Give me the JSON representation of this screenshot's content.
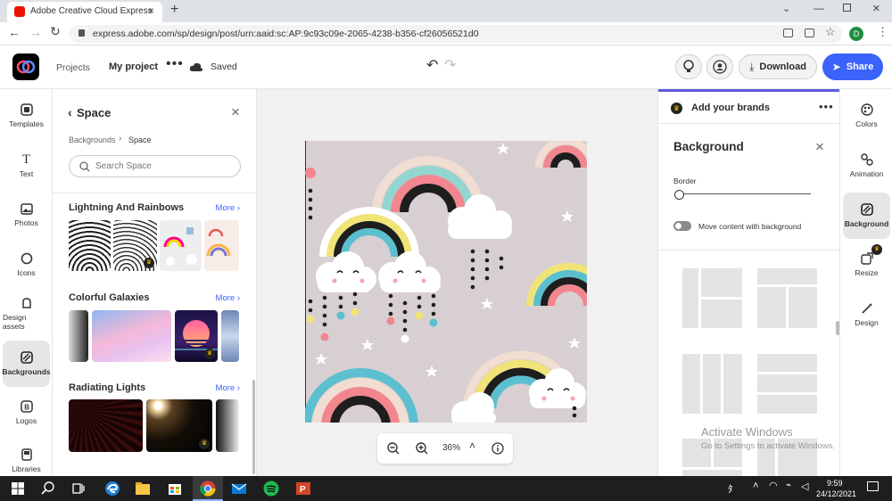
{
  "browser": {
    "tab_title": "Adobe Creative Cloud Express",
    "url": "express.adobe.com/sp/design/post/urn:aaid:sc:AP:9c93c09e-2065-4238-b356-cf26056521d0",
    "profile_initial": "D"
  },
  "header": {
    "projects": "Projects",
    "project_name": "My project",
    "status": "Saved",
    "download": "Download",
    "share": "Share"
  },
  "left_rail": [
    {
      "label": "Templates",
      "icon": "templates-icon"
    },
    {
      "label": "Text",
      "icon": "text-icon"
    },
    {
      "label": "Photos",
      "icon": "photos-icon"
    },
    {
      "label": "Icons",
      "icon": "icons-icon"
    },
    {
      "label": "Design assets",
      "icon": "design-assets-icon"
    },
    {
      "label": "Backgrounds",
      "icon": "backgrounds-icon",
      "active": true
    },
    {
      "label": "Logos",
      "icon": "logos-icon"
    },
    {
      "label": "Libraries",
      "icon": "libraries-icon"
    }
  ],
  "panel": {
    "title": "Space",
    "breadcrumb_root": "Backgrounds",
    "breadcrumb_current": "Space",
    "search_placeholder": "Search Space",
    "sections": [
      {
        "title": "Lightning And Rainbows",
        "more": "More"
      },
      {
        "title": "Colorful Galaxies",
        "more": "More"
      },
      {
        "title": "Radiating Lights",
        "more": "More"
      }
    ]
  },
  "canvas": {
    "zoom": "36%"
  },
  "right_panel": {
    "brands": "Add your brands",
    "title": "Background",
    "border_label": "Border",
    "move_label": "Move content with background"
  },
  "right_rail": [
    {
      "label": "Colors",
      "icon": "colors-icon"
    },
    {
      "label": "Animation",
      "icon": "animation-icon"
    },
    {
      "label": "Background",
      "icon": "background-icon",
      "active": true
    },
    {
      "label": "Resize",
      "icon": "resize-icon"
    },
    {
      "label": "Design",
      "icon": "design-icon"
    }
  ],
  "watermark": {
    "line1": "Activate Windows",
    "line2": "Go to Settings to activate Windows."
  },
  "taskbar": {
    "time": "9:59",
    "date": "24/12/2021"
  },
  "colors": {
    "accent": "#3b63fb",
    "canvas_bg": "#d8cfd2"
  }
}
